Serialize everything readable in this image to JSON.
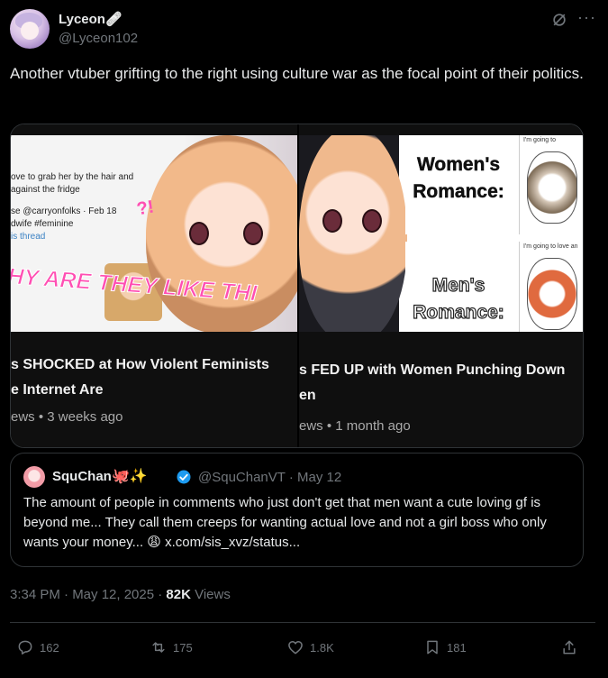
{
  "author": {
    "name": "Lyceon🩹",
    "handle": "@Lyceon102"
  },
  "tweet": {
    "text": "Another vtuber grifting to the right using culture war as the focal point of their politics."
  },
  "media": {
    "left": {
      "snippet_line1": "ove to grab her by the hair and",
      "snippet_line2": "against the fridge",
      "snippet_line3": "se @carryonfolks · Feb 18",
      "snippet_line4": "dwife #feminine",
      "snippet_line5": "is thread",
      "banner": "HY ARE THEY LIKE THI",
      "sfx": "?!",
      "title_line1": "s SHOCKED at How Violent Feminists",
      "title_line2": "e Internet Are",
      "meta": "ews • 3 weeks ago"
    },
    "right": {
      "panel1": "Women's Romance:",
      "panel2": "Men's Romance:",
      "comic1_caption": "I'm going to",
      "comic2_caption": "I'm going to love an",
      "title_line1": "s FED UP with Women Punching Down",
      "title_line2": "en",
      "meta": "ews • 1 month ago"
    }
  },
  "quote": {
    "name": "SquChan",
    "emoji": "🐙✨",
    "handle_date": "@SquChanVT · May 12",
    "text": "The amount of people in comments who just don't get that men want a cute loving gf is beyond me... They call them creeps for wanting actual love and not a girl boss who only wants your money... 😩",
    "link": "x.com/sis_xvz/status..."
  },
  "meta": {
    "timestamp": "3:34 PM · May 12, 2025 · ",
    "views_count": "82K",
    "views_label": " Views"
  },
  "actions": {
    "replies": "162",
    "reposts": "175",
    "likes": "1.8K",
    "bookmarks": "181"
  },
  "colors": {
    "background": "#000000",
    "text": "#e7e9ea",
    "muted": "#71767b",
    "border": "#2f3336",
    "verified": "#1d9bf0"
  }
}
